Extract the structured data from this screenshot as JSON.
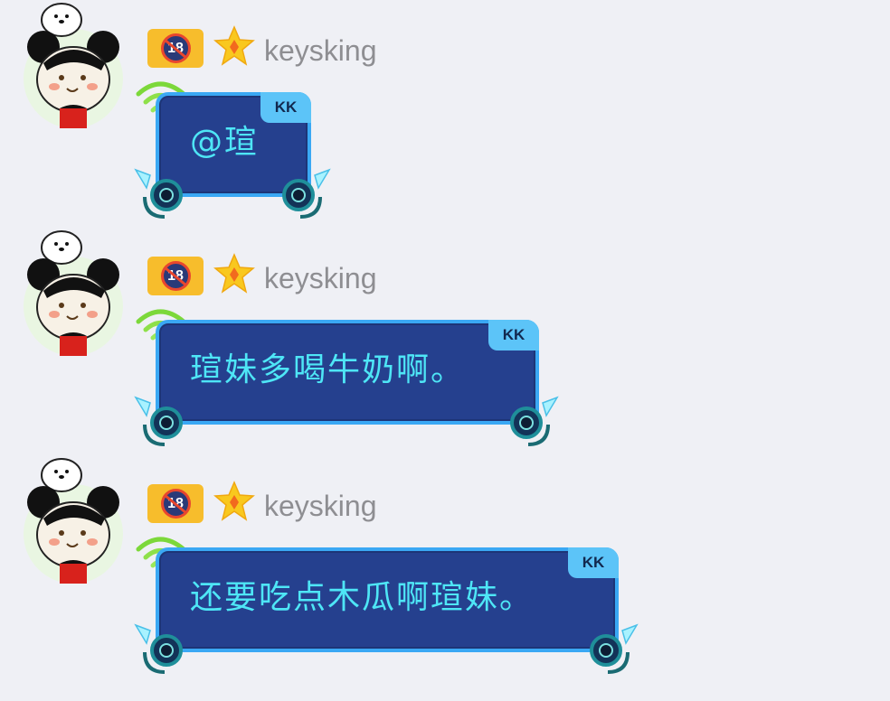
{
  "colors": {
    "background": "#eff0f5",
    "bubble_fill": "#25408e",
    "bubble_border": "#3aa8f4",
    "bubble_text": "#4ee6f6",
    "kk_tag": "#5cc4f8",
    "badge_yellow": "#f7bd2c",
    "nickname_gray": "#8e8e92"
  },
  "messages": [
    {
      "sender": "keysking",
      "level_badge": "18",
      "bubble_tag": "KK",
      "text": "@瑄"
    },
    {
      "sender": "keysking",
      "level_badge": "18",
      "bubble_tag": "KK",
      "text": "瑄妹多喝牛奶啊。"
    },
    {
      "sender": "keysking",
      "level_badge": "18",
      "bubble_tag": "KK",
      "text": "还要吃点木瓜啊瑄妹。"
    }
  ],
  "icons": {
    "avatar": "cartoon-mouse-avatar-icon",
    "level_badge": "no-18-badge-icon",
    "star": "star-badge-icon",
    "wifi": "wifi-signal-icon",
    "corner": "wheel-crystal-corner-icon"
  }
}
